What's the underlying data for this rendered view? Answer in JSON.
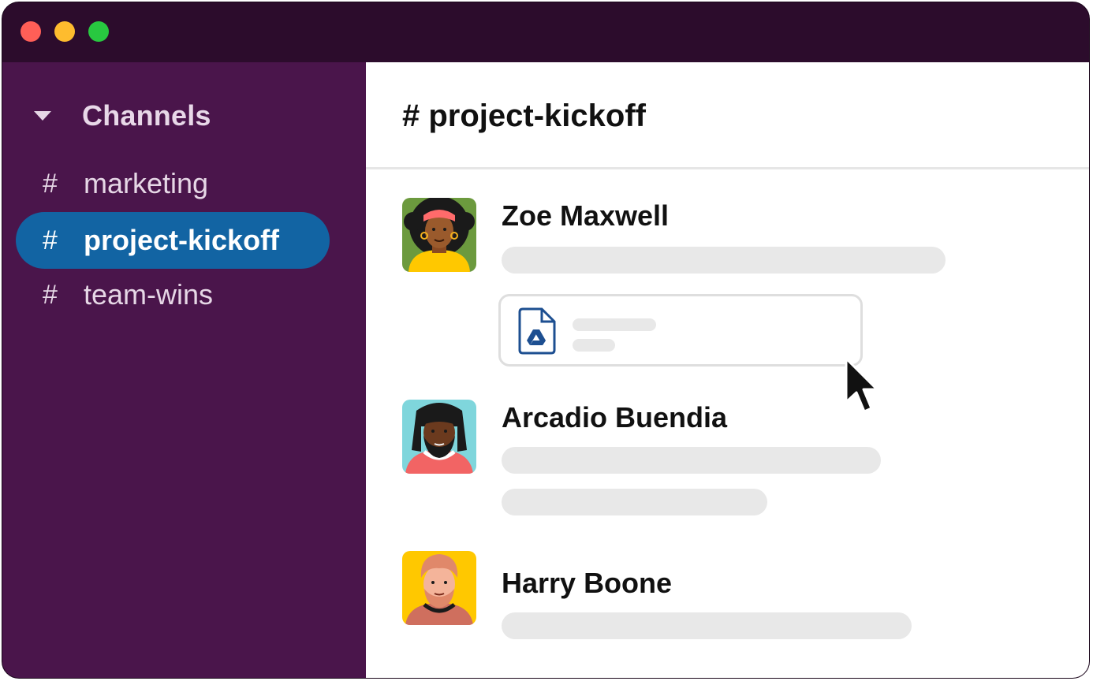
{
  "window": {
    "traffic_lights": [
      {
        "name": "close",
        "color": "#ff5f57"
      },
      {
        "name": "minimize",
        "color": "#febc2e"
      },
      {
        "name": "zoom",
        "color": "#28c840"
      }
    ]
  },
  "sidebar": {
    "section_icon": "caret-down-icon",
    "section_title": "Channels",
    "channels": [
      {
        "hash": "#",
        "label": "marketing",
        "active": false
      },
      {
        "hash": "#",
        "label": "project-kickoff",
        "active": true
      },
      {
        "hash": "#",
        "label": "team-wins",
        "active": false
      }
    ]
  },
  "main": {
    "channel_title": "# project-kickoff",
    "messages": [
      {
        "author": "Zoe Maxwell",
        "avatar": "avatar-zoe",
        "attachment_icon": "google-drive-file-icon"
      },
      {
        "author": "Arcadio Buendia",
        "avatar": "avatar-arcadio"
      },
      {
        "author": "Harry Boone",
        "avatar": "avatar-harry"
      }
    ]
  },
  "colors": {
    "titlebar": "#2c0c2c",
    "sidebar": "#4a154b",
    "active_channel": "#1264a3",
    "placeholder": "#e8e8e8"
  },
  "pointer": "mouse-pointer-icon"
}
